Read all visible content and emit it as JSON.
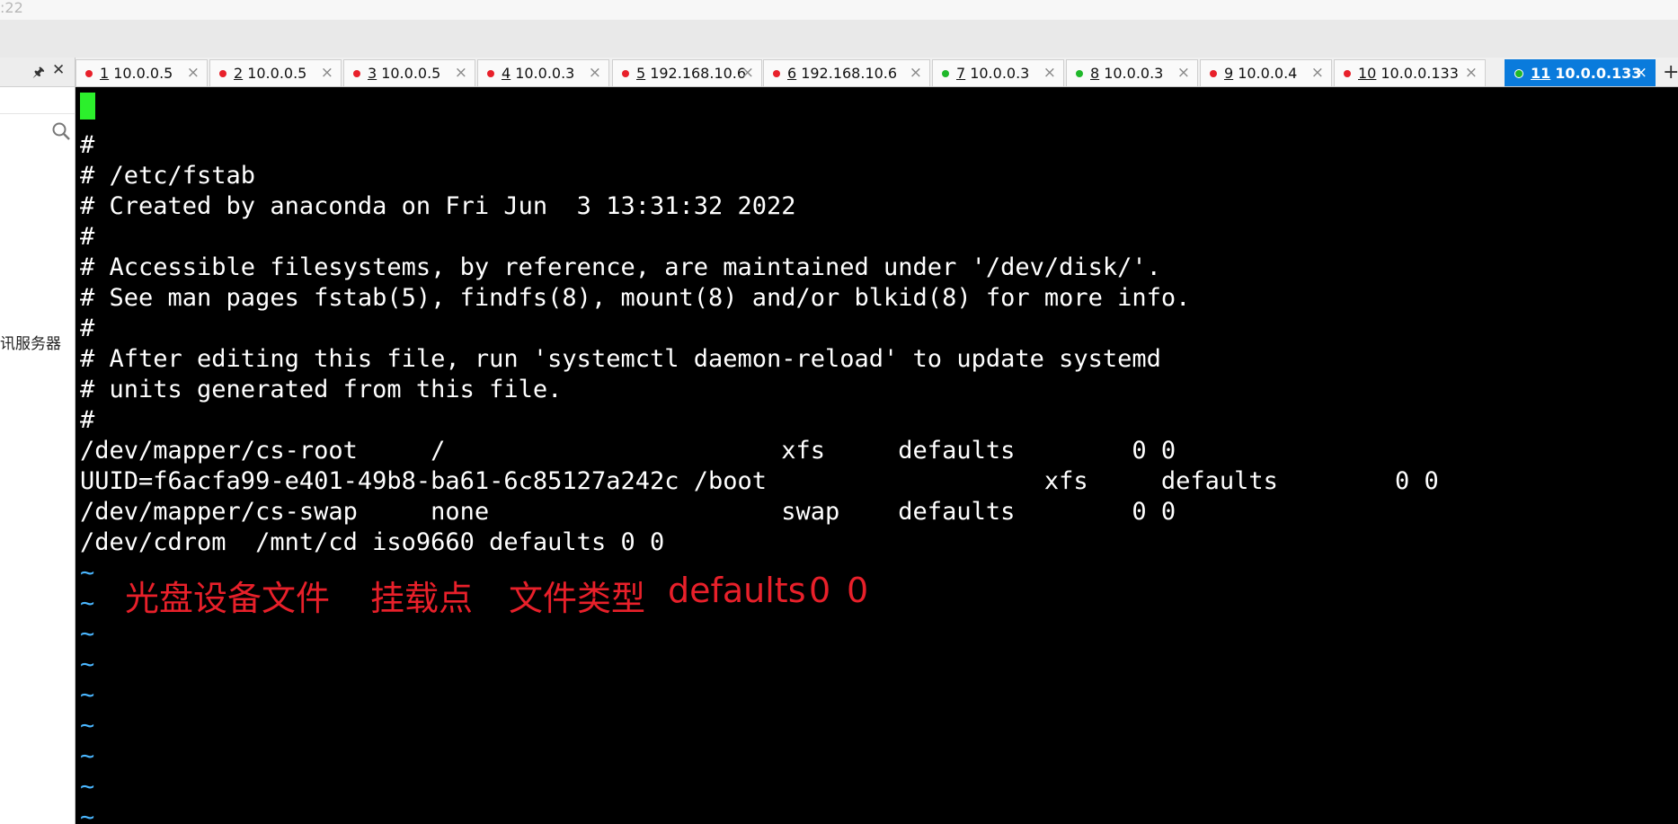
{
  "top_clock": ":22",
  "left_panel": {
    "pin_icon": "pin-icon",
    "close_icon": "close-icon",
    "search_icon": "search-icon",
    "server_item_label": "讯服务器"
  },
  "tabs": [
    {
      "num": "1",
      "host": "10.0.0.5",
      "status": "red"
    },
    {
      "num": "2",
      "host": "10.0.0.5",
      "status": "red"
    },
    {
      "num": "3",
      "host": "10.0.0.5",
      "status": "red"
    },
    {
      "num": "4",
      "host": "10.0.0.3",
      "status": "red"
    },
    {
      "num": "5",
      "host": "192.168.10.6",
      "status": "red"
    },
    {
      "num": "6",
      "host": "192.168.10.6",
      "status": "red"
    },
    {
      "num": "7",
      "host": "10.0.0.3",
      "status": "green"
    },
    {
      "num": "8",
      "host": "10.0.0.3",
      "status": "green"
    },
    {
      "num": "9",
      "host": "10.0.0.4",
      "status": "red"
    },
    {
      "num": "10",
      "host": "10.0.0.133",
      "status": "red"
    },
    {
      "num": "11",
      "host": "10.0.0.133",
      "status": "green",
      "active": true
    }
  ],
  "tab_close_glyph": "×",
  "tab_add_glyph": "+",
  "colors": {
    "status_red": "#e8202a",
    "status_green": "#1fb82a",
    "active_tab": "#0a7bdc",
    "terminal_bg": "#000000",
    "cursor": "#2cf02c",
    "tilde": "#4ab6ff",
    "annotation": "#e8202a"
  },
  "terminal": {
    "lines": [
      "",
      "#",
      "# /etc/fstab",
      "# Created by anaconda on Fri Jun  3 13:31:32 2022",
      "#",
      "# Accessible filesystems, by reference, are maintained under '/dev/disk/'.",
      "# See man pages fstab(5), findfs(8), mount(8) and/or blkid(8) for more info.",
      "#",
      "# After editing this file, run 'systemctl daemon-reload' to update systemd",
      "# units generated from this file.",
      "#",
      "/dev/mapper/cs-root     /                       xfs     defaults        0 0",
      "UUID=f6acfa99-e401-49b8-ba61-6c85127a242c /boot                   xfs     defaults        0 0",
      "/dev/mapper/cs-swap     none                    swap    defaults        0 0",
      "/dev/cdrom  /mnt/cd iso9660 defaults 0 0"
    ],
    "tilde_lines": [
      "~",
      "~",
      "~",
      "~",
      "~",
      "~",
      "~",
      "~",
      "~"
    ]
  },
  "annotation": {
    "device": "光盘设备文件",
    "mount_point": "挂载点",
    "fs_type": "文件类型",
    "options": "defaults",
    "dump": "0",
    "pass": "0"
  }
}
